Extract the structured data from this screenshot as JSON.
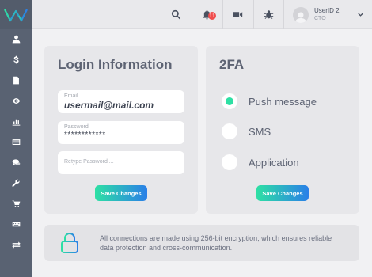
{
  "header": {
    "notification_count": "11",
    "user_name": "UserID 2",
    "user_role": "CTO"
  },
  "sidebar": {
    "items": [
      {
        "icon": "user-icon"
      },
      {
        "icon": "dollar-icon"
      },
      {
        "icon": "document-icon"
      },
      {
        "icon": "eye-icon"
      },
      {
        "icon": "bar-chart-icon"
      },
      {
        "icon": "credit-card-icon"
      },
      {
        "icon": "chat-icon"
      },
      {
        "icon": "wrench-icon"
      },
      {
        "icon": "cart-icon"
      },
      {
        "icon": "keyboard-icon"
      },
      {
        "icon": "transfer-icon"
      }
    ]
  },
  "login": {
    "title": "Login Information",
    "email_label": "Email",
    "email_value": "usermail@mail.com",
    "password_label": "Password",
    "password_value": "************",
    "retype_placeholder": "Retype Password ...",
    "save_label": "Save Changes"
  },
  "twofa": {
    "title": "2FA",
    "options": [
      "Push message",
      "SMS",
      "Application"
    ],
    "selected": "Push message",
    "save_label": "Save Changes"
  },
  "info": {
    "text": "All connections are made using 256-bit encryption, which ensures reliable data protection and cross-communication."
  },
  "colors": {
    "sidebar": "#596272",
    "accent_green": "#2ee0a4",
    "accent_blue": "#2a7fe8",
    "badge": "#f04d4d"
  }
}
